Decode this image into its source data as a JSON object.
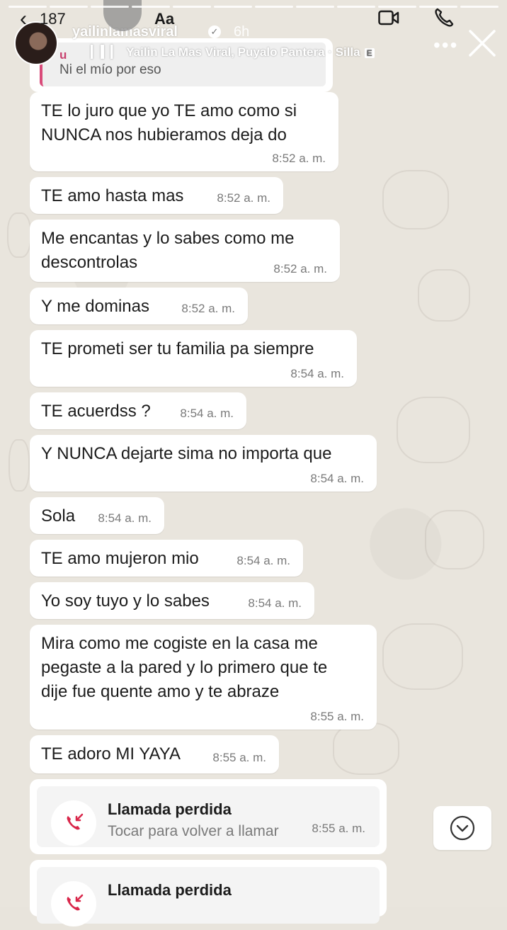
{
  "story": {
    "viewer_count": "187",
    "text_tool": "Aa",
    "username": "yailinlamasviral",
    "time_ago": "6h",
    "music": "Yailin La Mas Viral, Puyalo Pantera · Silla",
    "explicit": "E",
    "more_dots": "•••",
    "back_glyph": "‹"
  },
  "quote": {
    "author": "u",
    "text": "Ni el mío por eso"
  },
  "messages": [
    {
      "text": "TE lo juro que yo TE amo como si\nNUNCA nos hubieramos deja do",
      "time": "8:52 a. m."
    },
    {
      "text": "TE amo hasta mas",
      "time": "8:52 a. m."
    },
    {
      "text": "Me encantas y lo sabes como me\ndescontrolas",
      "time": "8:52 a. m."
    },
    {
      "text": "Y me dominas",
      "time": "8:52 a. m."
    },
    {
      "text": "TE prometi ser tu familia pa siempre",
      "time": "8:54 a. m."
    },
    {
      "text": "TE acuerdss ?",
      "time": "8:54 a. m."
    },
    {
      "text": "Y NUNCA dejarte sima no importa que",
      "time": "8:54 a. m."
    },
    {
      "text": "Sola",
      "time": "8:54 a. m."
    },
    {
      "text": "TE amo mujeron mio",
      "time": "8:54 a. m."
    },
    {
      "text": "Yo soy tuyo y lo sabes",
      "time": "8:54 a. m."
    },
    {
      "text": "Mira como me cogiste en la casa me\npegaste a la pared y lo primero que te\ndije fue quente amo y te abraze",
      "time": "8:55 a. m."
    },
    {
      "text": "TE adoro MI YAYA",
      "time": "8:55 a. m."
    }
  ],
  "calls": [
    {
      "title": "Llamada perdida",
      "subtitle": "Tocar para volver a llamar",
      "time": "8:55 a. m."
    },
    {
      "title": "Llamada perdida",
      "subtitle": "",
      "time": ""
    }
  ],
  "colors": {
    "accent_missed": "#d9264a",
    "bubble": "#ffffff",
    "quote_bar": "#d94b7a"
  }
}
